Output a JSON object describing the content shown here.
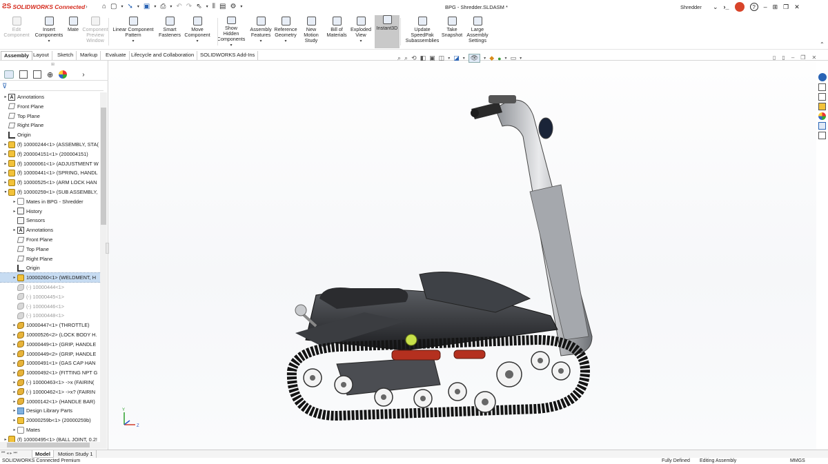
{
  "app": {
    "logo": "SOLIDWORKS Connected",
    "doc_title": "BPG - Shredder.SLDASM *",
    "user": "Shredder"
  },
  "ribbon": [
    {
      "label": "Edit Component",
      "disabled": true
    },
    {
      "label": "Insert Components"
    },
    {
      "label": "Mate"
    },
    {
      "label": "Component Preview Window",
      "disabled": true
    },
    {
      "label": "Linear Component Pattern"
    },
    {
      "label": "Smart Fasteners"
    },
    {
      "label": "Move Component"
    },
    {
      "label": "Show Hidden Components"
    },
    {
      "label": "Assembly Features"
    },
    {
      "label": "Reference Geometry"
    },
    {
      "label": "New Motion Study"
    },
    {
      "label": "Bill of Materials"
    },
    {
      "label": "Exploded View"
    },
    {
      "label": "Instant3D",
      "active": true
    },
    {
      "label": "Update SpeedPak Subassemblies"
    },
    {
      "label": "Take Snapshot"
    },
    {
      "label": "Large Assembly Settings"
    }
  ],
  "cmd_tabs": [
    "Assembly",
    "Layout",
    "Sketch",
    "Markup",
    "Evaluate",
    "Lifecycle and Collaboration",
    "SOLIDWORKS Add-Ins"
  ],
  "tree": [
    {
      "label": "Annotations",
      "icon": "anno",
      "indent": 0,
      "arrow": "▸"
    },
    {
      "label": "Front Plane",
      "icon": "plane",
      "indent": 0,
      "arrow": ""
    },
    {
      "label": "Top Plane",
      "icon": "plane",
      "indent": 0,
      "arrow": ""
    },
    {
      "label": "Right Plane",
      "icon": "plane",
      "indent": 0,
      "arrow": ""
    },
    {
      "label": "Origin",
      "icon": "origin",
      "indent": 0,
      "arrow": ""
    },
    {
      "label": "(f) 10000244<1> (ASSEMBLY, STA(",
      "icon": "asm",
      "indent": 0,
      "arrow": "▸"
    },
    {
      "label": "(f) 200004151<1> (200004151)",
      "icon": "asm",
      "indent": 0,
      "arrow": "▸"
    },
    {
      "label": "(f) 10000061<1> (ADJUSTMENT W",
      "icon": "asm",
      "indent": 0,
      "arrow": "▸"
    },
    {
      "label": "(f) 10000441<1> (SPRING, HANDL",
      "icon": "asm",
      "indent": 0,
      "arrow": "▸"
    },
    {
      "label": "(f) 10000525<1> (ARM LOCK HAN",
      "icon": "asm",
      "indent": 0,
      "arrow": "▸"
    },
    {
      "label": "(f) 10000259<1> (SUB ASSEMBLY,",
      "icon": "asm",
      "indent": 0,
      "arrow": "▾"
    },
    {
      "label": "Mates in BPG - Shredder",
      "icon": "mate",
      "indent": 1,
      "arrow": "▸"
    },
    {
      "label": "History",
      "icon": "sens",
      "indent": 1,
      "arrow": "▸"
    },
    {
      "label": "Sensors",
      "icon": "sens",
      "indent": 1,
      "arrow": ""
    },
    {
      "label": "Annotations",
      "icon": "anno",
      "indent": 1,
      "arrow": "▸"
    },
    {
      "label": "Front Plane",
      "icon": "plane",
      "indent": 1,
      "arrow": ""
    },
    {
      "label": "Top Plane",
      "icon": "plane",
      "indent": 1,
      "arrow": ""
    },
    {
      "label": "Right Plane",
      "icon": "plane",
      "indent": 1,
      "arrow": ""
    },
    {
      "label": "Origin",
      "icon": "origin",
      "indent": 1,
      "arrow": ""
    },
    {
      "label": "10000260<1> (WELDMENT, H",
      "icon": "asm",
      "indent": 1,
      "arrow": "▸",
      "selected": true
    },
    {
      "label": "(-) 10000444<1>",
      "icon": "greypart",
      "indent": 1,
      "arrow": "",
      "grey": true
    },
    {
      "label": "(-) 10000445<1>",
      "icon": "greypart",
      "indent": 1,
      "arrow": "",
      "grey": true
    },
    {
      "label": "(-) 10000446<1>",
      "icon": "greypart",
      "indent": 1,
      "arrow": "",
      "grey": true
    },
    {
      "label": "(-) 10000448<1>",
      "icon": "greypart",
      "indent": 1,
      "arrow": "",
      "grey": true
    },
    {
      "label": "10000447<1> (THROTTLE)",
      "icon": "part",
      "indent": 1,
      "arrow": "▸"
    },
    {
      "label": "10000526<2> (LOCK BODY H.",
      "icon": "part",
      "indent": 1,
      "arrow": "▸"
    },
    {
      "label": "10000449<1> (GRIP, HANDLE",
      "icon": "part",
      "indent": 1,
      "arrow": "▸"
    },
    {
      "label": "10000449<2> (GRIP, HANDLE",
      "icon": "part",
      "indent": 1,
      "arrow": "▸"
    },
    {
      "label": "10000491<1> (GAS CAP HAN",
      "icon": "part",
      "indent": 1,
      "arrow": "▸"
    },
    {
      "label": "10000492<1> (FITTING NPT G",
      "icon": "part",
      "indent": 1,
      "arrow": "▸"
    },
    {
      "label": "(-) 10000463<1> ->x (FAIRIN(",
      "icon": "part",
      "indent": 1,
      "arrow": "▸"
    },
    {
      "label": "(-) 10000462<1> ->x? (FAIRIN",
      "icon": "part",
      "indent": 1,
      "arrow": "▸"
    },
    {
      "label": "10000142<1> (HANDLE BAR)",
      "icon": "part",
      "indent": 1,
      "arrow": "▸"
    },
    {
      "label": "Design Library Parts",
      "icon": "folder",
      "indent": 1,
      "arrow": "▸"
    },
    {
      "label": "20000259b<1> (20000259b)",
      "icon": "asm",
      "indent": 1,
      "arrow": "▸"
    },
    {
      "label": "Mates",
      "icon": "mate",
      "indent": 1,
      "arrow": "▸"
    },
    {
      "label": "(f) 10000495<1> (BALL JOINT, 0.2!",
      "icon": "asm",
      "indent": 0,
      "arrow": "▸"
    }
  ],
  "bottom_tabs": [
    "Model",
    "Motion Study 1"
  ],
  "status": {
    "left": "SOLIDWORKS Connected Premium",
    "defined": "Fully Defined",
    "mode": "Editing Assembly",
    "units": "MMGS"
  },
  "colors": {
    "accent": "#d52b1e",
    "ribbon_active": "#c9c9c9",
    "selection": "#c7dcf2"
  }
}
